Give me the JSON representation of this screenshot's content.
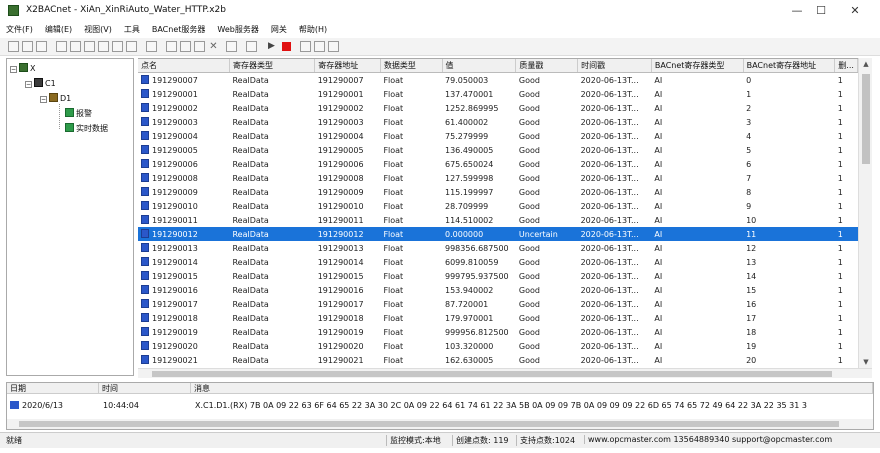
{
  "window": {
    "title": "X2BACnet - XiAn_XinRiAuto_Water_HTTP.x2b",
    "minimize": "—",
    "maximize": "☐",
    "close": "✕"
  },
  "menu": [
    "文件(F)",
    "编辑(E)",
    "视图(V)",
    "工具",
    "BACnet服务器",
    "Web服务器",
    "网关",
    "帮助(H)"
  ],
  "tree": {
    "root": "X",
    "channel": "C1",
    "device": "D1",
    "items": [
      "报警",
      "实时数据"
    ]
  },
  "grid": {
    "columns": [
      "点名",
      "寄存器类型",
      "寄存器地址",
      "数据类型",
      "值",
      "质量戳",
      "时间戳",
      "BACnet寄存器类型",
      "BACnet寄存器地址",
      "删..."
    ],
    "rows": [
      [
        "191290007",
        "RealData",
        "191290007",
        "Float",
        "79.050003",
        "Good",
        "2020-06-13T...",
        "AI",
        "0",
        "1"
      ],
      [
        "191290001",
        "RealData",
        "191290001",
        "Float",
        "137.470001",
        "Good",
        "2020-06-13T...",
        "AI",
        "1",
        "1"
      ],
      [
        "191290002",
        "RealData",
        "191290002",
        "Float",
        "1252.869995",
        "Good",
        "2020-06-13T...",
        "AI",
        "2",
        "1"
      ],
      [
        "191290003",
        "RealData",
        "191290003",
        "Float",
        "61.400002",
        "Good",
        "2020-06-13T...",
        "AI",
        "3",
        "1"
      ],
      [
        "191290004",
        "RealData",
        "191290004",
        "Float",
        "75.279999",
        "Good",
        "2020-06-13T...",
        "AI",
        "4",
        "1"
      ],
      [
        "191290005",
        "RealData",
        "191290005",
        "Float",
        "136.490005",
        "Good",
        "2020-06-13T...",
        "AI",
        "5",
        "1"
      ],
      [
        "191290006",
        "RealData",
        "191290006",
        "Float",
        "675.650024",
        "Good",
        "2020-06-13T...",
        "AI",
        "6",
        "1"
      ],
      [
        "191290008",
        "RealData",
        "191290008",
        "Float",
        "127.599998",
        "Good",
        "2020-06-13T...",
        "AI",
        "7",
        "1"
      ],
      [
        "191290009",
        "RealData",
        "191290009",
        "Float",
        "115.199997",
        "Good",
        "2020-06-13T...",
        "AI",
        "8",
        "1"
      ],
      [
        "191290010",
        "RealData",
        "191290010",
        "Float",
        "28.709999",
        "Good",
        "2020-06-13T...",
        "AI",
        "9",
        "1"
      ],
      [
        "191290011",
        "RealData",
        "191290011",
        "Float",
        "114.510002",
        "Good",
        "2020-06-13T...",
        "AI",
        "10",
        "1"
      ],
      [
        "191290012",
        "RealData",
        "191290012",
        "Float",
        "0.000000",
        "Uncertain",
        "2020-06-13T...",
        "AI",
        "11",
        "1"
      ],
      [
        "191290013",
        "RealData",
        "191290013",
        "Float",
        "998356.687500",
        "Good",
        "2020-06-13T...",
        "AI",
        "12",
        "1"
      ],
      [
        "191290014",
        "RealData",
        "191290014",
        "Float",
        "6099.810059",
        "Good",
        "2020-06-13T...",
        "AI",
        "13",
        "1"
      ],
      [
        "191290015",
        "RealData",
        "191290015",
        "Float",
        "999795.937500",
        "Good",
        "2020-06-13T...",
        "AI",
        "14",
        "1"
      ],
      [
        "191290016",
        "RealData",
        "191290016",
        "Float",
        "153.940002",
        "Good",
        "2020-06-13T...",
        "AI",
        "15",
        "1"
      ],
      [
        "191290017",
        "RealData",
        "191290017",
        "Float",
        "87.720001",
        "Good",
        "2020-06-13T...",
        "AI",
        "16",
        "1"
      ],
      [
        "191290018",
        "RealData",
        "191290018",
        "Float",
        "179.970001",
        "Good",
        "2020-06-13T...",
        "AI",
        "17",
        "1"
      ],
      [
        "191290019",
        "RealData",
        "191290019",
        "Float",
        "999956.812500",
        "Good",
        "2020-06-13T...",
        "AI",
        "18",
        "1"
      ],
      [
        "191290020",
        "RealData",
        "191290020",
        "Float",
        "103.320000",
        "Good",
        "2020-06-13T...",
        "AI",
        "19",
        "1"
      ],
      [
        "191290021",
        "RealData",
        "191290021",
        "Float",
        "162.630005",
        "Good",
        "2020-06-13T...",
        "AI",
        "20",
        "1"
      ]
    ]
  },
  "log": {
    "headers": [
      "日期",
      "时间",
      "消息"
    ],
    "date": "2020/6/13",
    "time": "10:44:04",
    "message": "X.C1.D1.(RX) 7B 0A 09 22 63 6F 64 65 22 3A 30 2C 0A 09 22 64 61 74 61 22 3A 5B 0A 09 09 7B 0A 09 09 09 22 6D 65 74 65 72 49 64 22 3A 22 35 31 3"
  },
  "status": {
    "ready": "就绪",
    "mode": "监控模式:本地",
    "created": "创建点数: 119",
    "support": "支持点数:1024",
    "contact": "www.opcmaster.com 13564889340 support@opcmaster.com"
  },
  "colors": {
    "selected_row": "#1a73d9",
    "row_icon": "#2b57c9"
  }
}
